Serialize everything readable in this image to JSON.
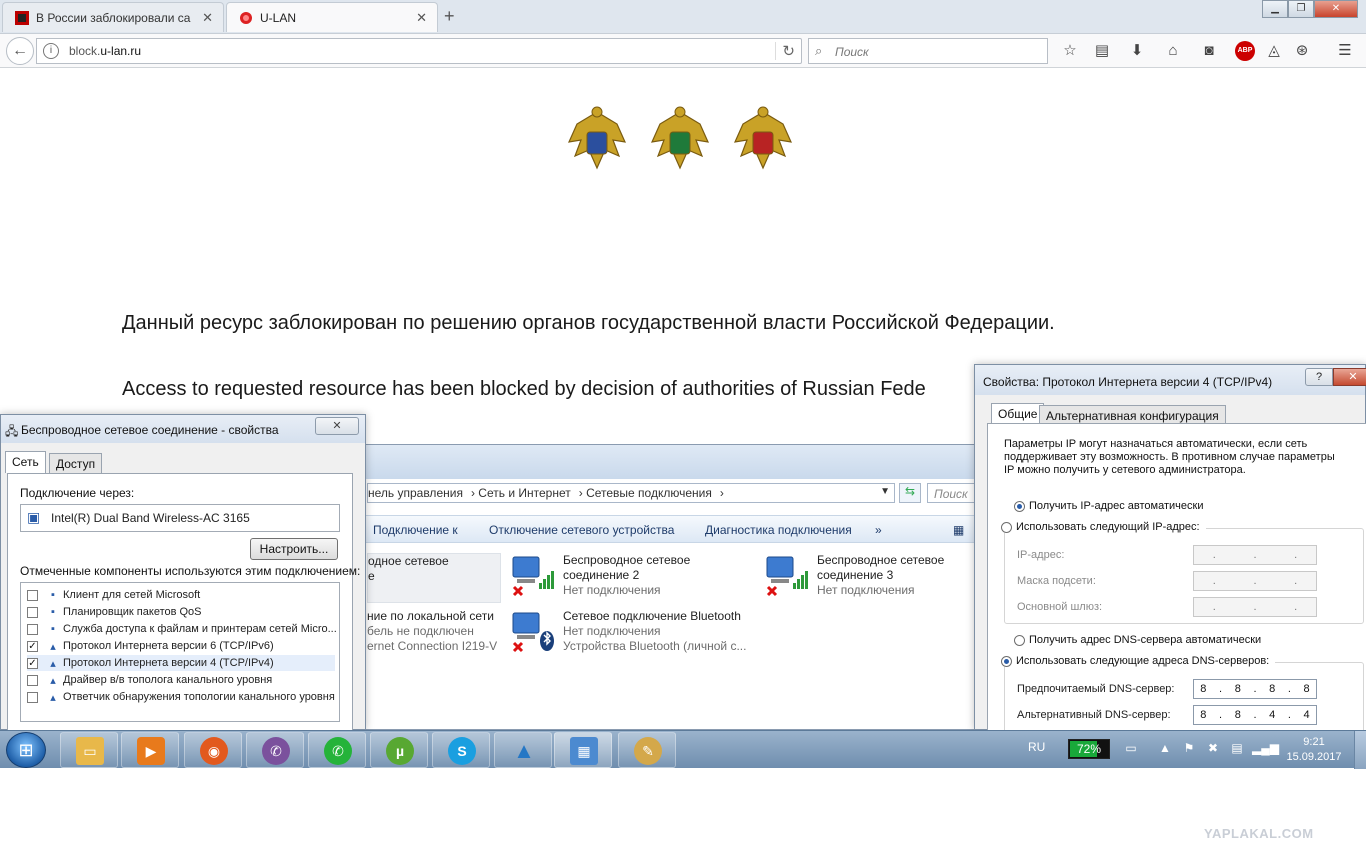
{
  "browser": {
    "tabs": [
      {
        "title": "В России заблокировали са",
        "active": false
      },
      {
        "title": "U-LAN",
        "active": true
      }
    ],
    "url_prefix": "block.",
    "url_domain": "u-lan.ru",
    "search_placeholder": "Поиск",
    "abp_label": "ABP"
  },
  "page": {
    "notice_ru": "Данный ресурс заблокирован по решению органов государственной власти Российской Федерации.",
    "notice_en": "Access to requested resource has been blocked by decision of authorities of Russian Fede"
  },
  "explorer": {
    "breadcrumb": [
      "нель управления",
      "Сеть и Интернет",
      "Сетевые подключения"
    ],
    "search_placeholder": "Поиск",
    "commands": [
      "Подключение к",
      "Отключение сетевого устройства",
      "Диагностика подключения"
    ],
    "connections": [
      {
        "name1": "одное сетевое",
        "name2": "е",
        "status": ""
      },
      {
        "name1": "Беспроводное сетевое",
        "name2": "соединение 2",
        "status": "Нет подключения"
      },
      {
        "name1": "Беспроводное сетевое",
        "name2": "соединение 3",
        "status": "Нет подключения"
      },
      {
        "name1": "ние по локальной сети",
        "name2": "бель не подключен",
        "status": "ernet Connection I219-V"
      },
      {
        "name1": "Сетевое подключение Bluetooth",
        "name2": "Нет подключения",
        "status": "Устройства Bluetooth (личной с..."
      }
    ]
  },
  "dialog_left": {
    "title": "Беспроводное сетевое соединение - свойства",
    "tabs": [
      "Сеть",
      "Доступ"
    ],
    "connect_via_label": "Подключение через:",
    "adapter": "Intel(R) Dual Band Wireless-AC 3165",
    "configure_button": "Настроить...",
    "components_label": "Отмеченные компоненты используются этим подключением:",
    "components": [
      {
        "label": "Клиент для сетей Microsoft",
        "checked": false
      },
      {
        "label": "Планировщик пакетов QoS",
        "checked": false
      },
      {
        "label": "Служба доступа к файлам и принтерам сетей Micro...",
        "checked": false
      },
      {
        "label": "Протокол Интернета версии 6 (TCP/IPv6)",
        "checked": true
      },
      {
        "label": "Протокол Интернета версии 4 (TCP/IPv4)",
        "checked": true
      },
      {
        "label": "Драйвер в/в тополога канального уровня",
        "checked": false
      },
      {
        "label": "Ответчик обнаружения топологии канального уровня",
        "checked": false
      }
    ]
  },
  "dialog_right": {
    "title": "Свойства: Протокол Интернета версии 4 (TCP/IPv4)",
    "help": "?",
    "tabs": [
      "Общие",
      "Альтернативная конфигурация"
    ],
    "intro": "Параметры IP могут назначаться автоматически, если сеть поддерживает эту возможность. В противном случае параметры IP можно получить у сетевого администратора.",
    "ip_auto": "Получить IP-адрес автоматически",
    "ip_manual": "Использовать следующий IP-адрес:",
    "ip_address_label": "IP-адрес:",
    "subnet_label": "Маска подсети:",
    "gateway_label": "Основной шлюз:",
    "dns_auto": "Получить адрес DNS-сервера автоматически",
    "dns_manual": "Использовать следующие адреса DNS-серверов:",
    "preferred_dns_label": "Предпочитаемый DNS-сервер:",
    "preferred_dns": [
      "8",
      "8",
      "8",
      "8"
    ],
    "alternate_dns_label": "Альтернативный DNS-сервер:",
    "alternate_dns": [
      "8",
      "8",
      "4",
      "4"
    ]
  },
  "taskbar": {
    "language": "RU",
    "battery_percent": 72,
    "battery_label": "72%",
    "time": "9:21",
    "date": "15.09.2017"
  },
  "watermark": "YAPLAKAL.COM",
  "colors": {
    "accent": "#2a5ca8",
    "battery": "#19a83a",
    "abp": "#cc0000"
  }
}
